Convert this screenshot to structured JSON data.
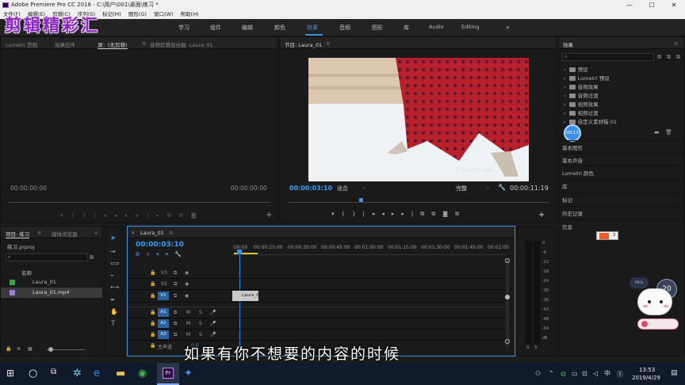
{
  "window": {
    "title": "Adobe Premiere Pro CC 2018 - C:\\用户\\001\\桌面\\练习 *"
  },
  "menu": [
    "文件(F)",
    "编辑(E)",
    "剪辑(C)",
    "序列(S)",
    "标记(M)",
    "图形(G)",
    "窗口(W)",
    "帮助(H)"
  ],
  "overlay_title": "剪辑精彩汇",
  "workspaces": [
    "学习",
    "组件",
    "编辑",
    "颜色",
    "效果",
    "音频",
    "图形",
    "库",
    "Audio",
    "Editing"
  ],
  "active_workspace": "效果",
  "source_panel": {
    "tabs": [
      "Lumetri 范围",
      "效果控件",
      "源：(无剪辑)",
      "音频剪辑混合器: Laura_01"
    ],
    "timecode_left": "00:00:00:00",
    "timecode_right": "00:00:00:00"
  },
  "program_panel": {
    "tab": "节目: Laura_01",
    "timecode": "00:00:03:10",
    "fit": "适合",
    "quality": "完整",
    "duration": "00:00:11:19",
    "watermark": "© Maxim Jago"
  },
  "project_panel": {
    "tabs": [
      "项目: 练习",
      "媒体浏览器"
    ],
    "project_file": "练习.prproj",
    "column_name": "名称",
    "items": [
      {
        "name": "Laura_01",
        "color": "#3fa14b"
      },
      {
        "name": "Laura_01.mp4",
        "color": "#9b7fd1"
      }
    ]
  },
  "timeline": {
    "tab": "Laura_01",
    "timecode": "00:00:03:10",
    "ruler": [
      ":00:00",
      "00:00:15:00",
      "00:00:30:00",
      "00:00:45:00",
      "00:01:00:00",
      "00:01:15:00",
      "00:01:30:00",
      "00:01:45:00",
      "00:02:00"
    ],
    "video_tracks": [
      "V3",
      "V2",
      "V1"
    ],
    "audio_tracks": [
      "A1",
      "A2",
      "A3"
    ],
    "master": "主声道",
    "master_value": "0.0",
    "clip_label": "Laura_0"
  },
  "effects_panel": {
    "title": "效果",
    "items": [
      "预设",
      "Lumetri 预设",
      "音频效果",
      "音频过渡",
      "视频效果",
      "视频过渡",
      "自定义素材箱 01"
    ],
    "sections": [
      "基本图形",
      "基本声音",
      "Lumetri 颜色",
      "库",
      "标记",
      "历史记录",
      "信息"
    ]
  },
  "audio_meter": {
    "labels": [
      "0",
      "-6",
      "-12",
      "-18",
      "-24",
      "-30",
      "-36",
      "-42",
      "-48",
      "-54",
      "dB"
    ],
    "solo": [
      "S",
      "S"
    ]
  },
  "badge_time": "00:13",
  "widget": {
    "speed": "0K/s",
    "value": "20"
  },
  "subtitle": "如果有你不想要的内容的时候",
  "taskbar": {
    "time": "13:53",
    "date": "2019/4/29",
    "ime": "中"
  }
}
